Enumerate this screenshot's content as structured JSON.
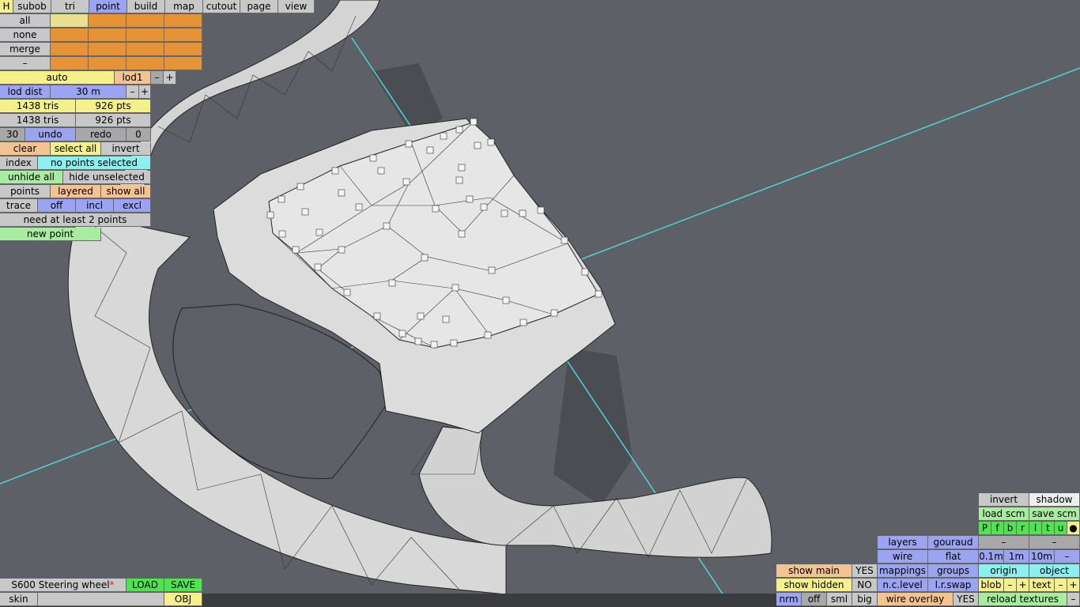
{
  "top_menu": {
    "h": "H",
    "tabs": [
      "subob",
      "tri",
      "point",
      "build",
      "map",
      "cutout",
      "page",
      "view"
    ],
    "active": "point"
  },
  "left_panel": {
    "sel_all": "all",
    "sel_none": "none",
    "sel_merge": "merge",
    "sel_dash": "–",
    "auto": "auto",
    "lod": "lod1",
    "minus": "–",
    "plus": "+",
    "lod_dist_label": "lod dist",
    "lod_dist_value": "30 m",
    "tris_1": "1438 tris",
    "pts_1": "926 pts",
    "tris_2": "1438 tris",
    "pts_2": "926 pts",
    "undo_count": "30",
    "undo": "undo",
    "redo": "redo",
    "redo_count": "0",
    "clear": "clear",
    "select_all": "select all",
    "invert": "invert",
    "index": "index",
    "no_points_selected": "no points selected",
    "unhide_all": "unhide all",
    "hide_unselected": "hide unselected",
    "points": "points",
    "layered": "layered",
    "show_all": "show all",
    "trace": "trace",
    "off": "off",
    "incl": "incl",
    "excl": "excl",
    "need_points": "need at least 2 points",
    "new_point": "new point"
  },
  "bottom_left": {
    "file_name": "S600 Steering wheel",
    "modified_mark": "*",
    "load": "LOAD",
    "save": "SAVE",
    "skin": "skin",
    "obj": "OBJ"
  },
  "bottom_right": {
    "invert": "invert",
    "shadow": "shadow",
    "load_scm": "load scm",
    "save_scm": "save scm",
    "flags": [
      "P",
      "f",
      "b",
      "r",
      "l",
      "t",
      "u",
      "●"
    ],
    "layers": "layers",
    "gouraud": "gouraud",
    "dash": "–",
    "wire": "wire",
    "flat": "flat",
    "grid_01": "0.1m",
    "grid_1": "1m",
    "grid_10": "10m",
    "show_main": "show main",
    "show_main_val": "YES",
    "mappings": "mappings",
    "groups": "groups",
    "origin": "origin",
    "object": "object",
    "show_hidden": "show hidden",
    "show_hidden_val": "NO",
    "nc_level": "n.c.level",
    "lr_swap": "l.r.swap",
    "blob": "blob",
    "text": "text",
    "minus": "–",
    "plus": "+",
    "nrm": "nrm",
    "off": "off",
    "sml": "sml",
    "big": "big",
    "wire_overlay": "wire overlay",
    "wire_overlay_val": "YES",
    "reload_textures": "reload textures"
  }
}
